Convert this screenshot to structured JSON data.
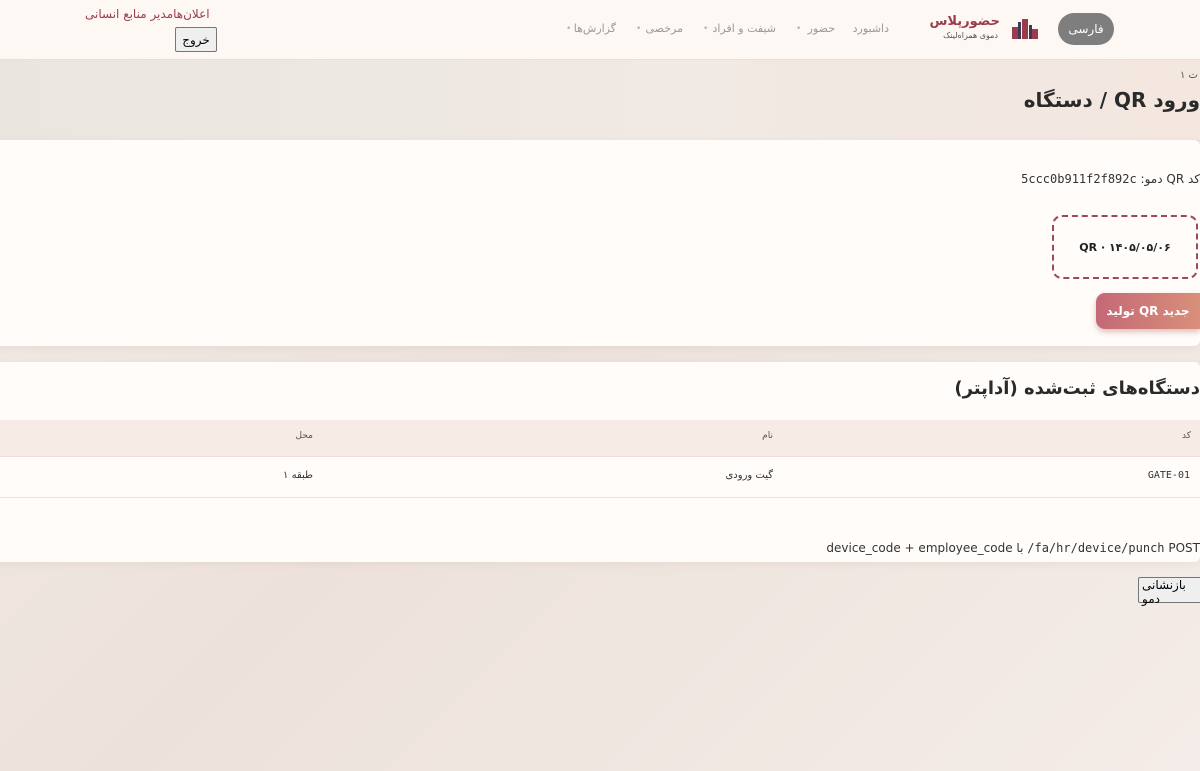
{
  "header": {
    "language_button": "فارسی",
    "brand_name": "حضورپلاس",
    "brand_subtitle": "دموی همراه‌لینک",
    "nav": [
      "داشبورد",
      "حضور",
      "شیفت و افراد",
      "مرخصی",
      "گزارش‌ها"
    ],
    "user_line": "اعلان‌هامدیر منابع انسانی",
    "logout_button": "خروج"
  },
  "page": {
    "breadcrumb": "ت ۱",
    "title": "ورود QR / دستگاه"
  },
  "qr_section": {
    "code_label": "کد QR دمو:",
    "code_value": "5ccc0b911f2f892c",
    "qr_box_text": "QR · ۱۴۰۵/۰۵/۰۶",
    "generate_button": "تولید QR جدید"
  },
  "devices_section": {
    "title": "دستگاه‌های ثبت‌شده (آداپتر)",
    "columns": [
      "کد",
      "نام",
      "محل"
    ],
    "rows": [
      {
        "code": "GATE-01",
        "name": "گیت ورودی",
        "location": "طبقه ۱"
      }
    ],
    "api_note_prefix": "POST",
    "api_note_path": "/fa/hr/device/punch",
    "api_note_suffix": "با device_code + employee_code"
  },
  "reset_button": "بازنشانی دمو",
  "colors": {
    "brand": "#9b3c4c",
    "accent_gradient_start": "#c46876",
    "accent_gradient_end": "#d98f7a",
    "language_button_bg": "#7e7e7e"
  }
}
